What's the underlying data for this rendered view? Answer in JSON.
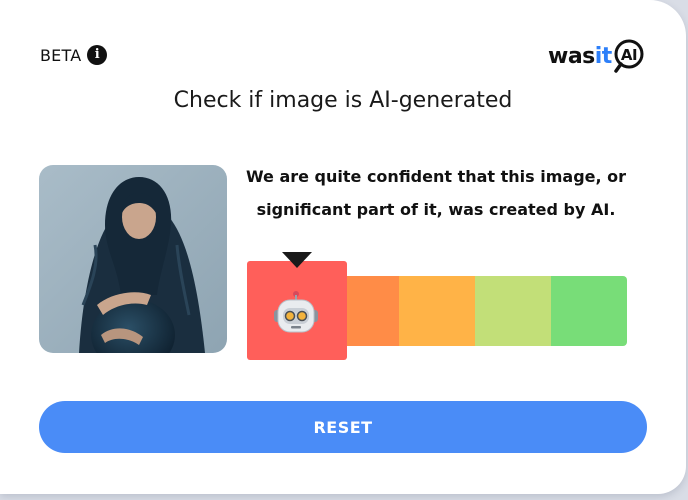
{
  "header": {
    "beta_label": "BETA",
    "logo_text_dark": "was",
    "logo_text_blue": "it",
    "logo_badge": "AI"
  },
  "title": "Check if image is AI-generated",
  "result": {
    "verdict_line1": "We are quite confident that this image, or",
    "verdict_line2": "significant part of it, was created by AI.",
    "meter_colors": [
      "#ff5f5a",
      "#ff8c47",
      "#ffb347",
      "#c2df78",
      "#78dd78"
    ],
    "selected_segment": 1,
    "indicator_icon": "robot-icon"
  },
  "actions": {
    "reset_label": "RESET"
  },
  "colors": {
    "accent": "#4a8cf7",
    "brand_blue": "#2d7ff9"
  }
}
